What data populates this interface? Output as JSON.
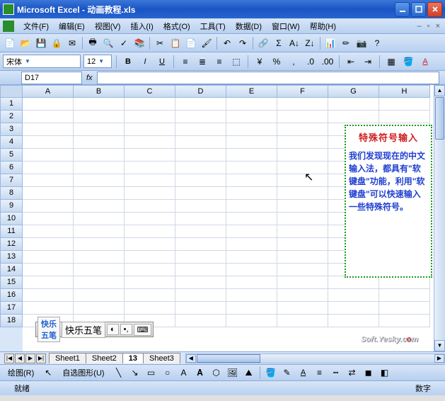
{
  "window": {
    "title": "Microsoft Excel - 动画教程.xls"
  },
  "menu": {
    "file": "文件(F)",
    "edit": "编辑(E)",
    "view": "视图(V)",
    "insert": "插入(I)",
    "format": "格式(O)",
    "tools": "工具(T)",
    "data": "数据(D)",
    "window": "窗口(W)",
    "help": "帮助(H)"
  },
  "format_bar": {
    "font_name": "宋体",
    "font_size": "12"
  },
  "reference": {
    "cell": "D17",
    "fx_label": "fx"
  },
  "columns": [
    "A",
    "B",
    "C",
    "D",
    "E",
    "F",
    "G",
    "H"
  ],
  "rows": [
    "1",
    "2",
    "3",
    "4",
    "5",
    "6",
    "7",
    "8",
    "9",
    "10",
    "11",
    "12",
    "13",
    "14",
    "15",
    "16",
    "17",
    "18"
  ],
  "textbox": {
    "title": "特殊符号输入",
    "body": "我们发现现在的中文输入法，都具有\"软键盘\"功能，利用\"软键盘\"可以快速输入一些特殊符号。"
  },
  "ime": {
    "logo": "快乐五笔"
  },
  "sheets": {
    "s1": "Sheet1",
    "s2": "Sheet2",
    "s3": "13",
    "s4": "Sheet3"
  },
  "drawbar": {
    "label": "绘图(R)",
    "autoshape": "自选图形(U)"
  },
  "status": {
    "ready": "就绪",
    "num": "数字"
  },
  "watermark": {
    "t1": "Soft.Yesky.c",
    "t2": "o",
    "t3": "m"
  }
}
